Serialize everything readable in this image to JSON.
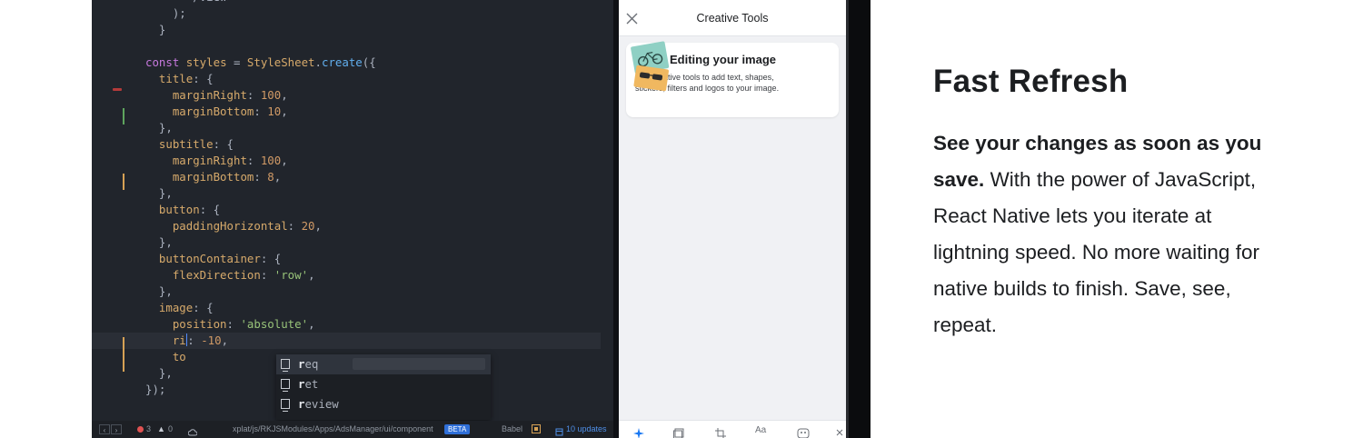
{
  "editor": {
    "lines": [
      [
        [
          "pn",
          "      </View>"
        ]
      ],
      [
        [
          "pn",
          "    );"
        ]
      ],
      [
        [
          "pn",
          "  }"
        ]
      ],
      [
        [
          "pn",
          ""
        ]
      ],
      [
        [
          "kw",
          "const "
        ],
        [
          "prop",
          "styles"
        ],
        [
          "pn",
          " = "
        ],
        [
          "prop",
          "StyleSheet"
        ],
        [
          "pn",
          "."
        ],
        [
          "fn",
          "create"
        ],
        [
          "pn",
          "({"
        ]
      ],
      [
        [
          "pn",
          "  "
        ],
        [
          "prop",
          "title"
        ],
        [
          "pn",
          ": {"
        ]
      ],
      [
        [
          "pn",
          "    "
        ],
        [
          "prop",
          "marginRight"
        ],
        [
          "pn",
          ": "
        ],
        [
          "num",
          "100"
        ],
        [
          "pn",
          ","
        ]
      ],
      [
        [
          "pn",
          "    "
        ],
        [
          "prop",
          "marginBottom"
        ],
        [
          "pn",
          ": "
        ],
        [
          "num",
          "10"
        ],
        [
          "pn",
          ","
        ]
      ],
      [
        [
          "pn",
          "  },"
        ]
      ],
      [
        [
          "pn",
          "  "
        ],
        [
          "prop",
          "subtitle"
        ],
        [
          "pn",
          ": {"
        ]
      ],
      [
        [
          "pn",
          "    "
        ],
        [
          "prop",
          "marginRight"
        ],
        [
          "pn",
          ": "
        ],
        [
          "num",
          "100"
        ],
        [
          "pn",
          ","
        ]
      ],
      [
        [
          "pn",
          "    "
        ],
        [
          "prop",
          "marginBottom"
        ],
        [
          "pn",
          ": "
        ],
        [
          "num",
          "8"
        ],
        [
          "pn",
          ","
        ]
      ],
      [
        [
          "pn",
          "  },"
        ]
      ],
      [
        [
          "pn",
          "  "
        ],
        [
          "prop",
          "button"
        ],
        [
          "pn",
          ": {"
        ]
      ],
      [
        [
          "pn",
          "    "
        ],
        [
          "prop",
          "paddingHorizontal"
        ],
        [
          "pn",
          ": "
        ],
        [
          "num",
          "20"
        ],
        [
          "pn",
          ","
        ]
      ],
      [
        [
          "pn",
          "  },"
        ]
      ],
      [
        [
          "pn",
          "  "
        ],
        [
          "prop",
          "buttonContainer"
        ],
        [
          "pn",
          ": {"
        ]
      ],
      [
        [
          "pn",
          "    "
        ],
        [
          "prop",
          "flexDirection"
        ],
        [
          "pn",
          ": "
        ],
        [
          "str",
          "'row'"
        ],
        [
          "pn",
          ","
        ]
      ],
      [
        [
          "pn",
          "  },"
        ]
      ],
      [
        [
          "pn",
          "  "
        ],
        [
          "prop",
          "image"
        ],
        [
          "pn",
          ": {"
        ]
      ],
      [
        [
          "pn",
          "    "
        ],
        [
          "prop",
          "position"
        ],
        [
          "pn",
          ": "
        ],
        [
          "str",
          "'absolute'"
        ],
        [
          "pn",
          ","
        ]
      ],
      [
        [
          "pn",
          "    "
        ],
        [
          "prop",
          "ri"
        ],
        [
          "cursor",
          ""
        ],
        [
          "pn",
          ": "
        ],
        [
          "num",
          "-10"
        ],
        [
          "pn",
          ","
        ]
      ],
      [
        [
          "pn",
          "    "
        ],
        [
          "prop",
          "to"
        ]
      ],
      [
        [
          "pn",
          "  },"
        ]
      ],
      [
        [
          "pn",
          "});"
        ]
      ]
    ],
    "autocomplete": [
      {
        "match": "r",
        "rest": "eq"
      },
      {
        "match": "r",
        "rest": "et"
      },
      {
        "match": "r",
        "rest": "eview"
      }
    ]
  },
  "status_bar": {
    "prev": "‹",
    "next": "›",
    "errors": "3",
    "warnings": "0",
    "path": "xplat/js/RKJSModules/Apps/AdsManager/ui/component",
    "beta": "BETA",
    "grammar": "Babel",
    "updates": "10 updates",
    "colors": {
      "error": "#e05252",
      "beta": "#2f6fd8",
      "updates": "#4f8fe8"
    }
  },
  "phone": {
    "nav_title": "Creative Tools",
    "card_title": "Editing your image",
    "card_body": "Use creative tools to add text, shapes, stickers, filters and logos to your image."
  },
  "marketing": {
    "heading": "Fast Refresh",
    "lead_bold": "See your changes as soon as you save.",
    "body": " With the power of JavaScript, React Native lets you iterate at lightning speed. No more waiting for native builds to finish. Save, see, repeat."
  }
}
